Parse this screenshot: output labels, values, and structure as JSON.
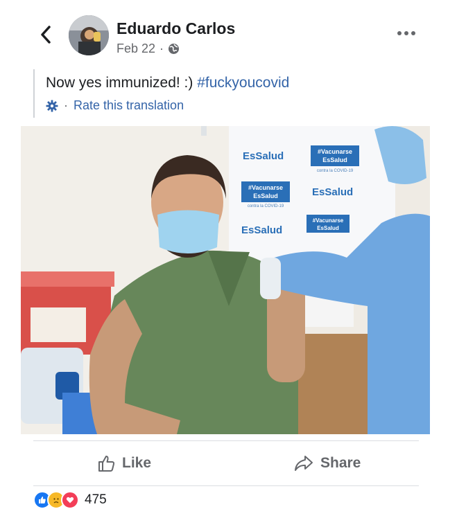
{
  "post": {
    "author": "Eduardo Carlos",
    "date": "Feb 22",
    "separator": "·",
    "text": "Now yes immunized! :) ",
    "hashtag": "#fuckyoucovid",
    "translate_separator": "·",
    "translate_label": "Rate this translation"
  },
  "photo": {
    "banner_brand": "EsSalud",
    "banner_tag_line1": "#Vacunarse",
    "banner_tag_line2": "EsSalud",
    "banner_small": "contra la COVID-19"
  },
  "actions": {
    "like_label": "Like",
    "share_label": "Share"
  },
  "reactions": {
    "count": "475",
    "icons": [
      "like-icon",
      "sad-icon",
      "love-icon"
    ]
  },
  "colors": {
    "link": "#3464a8",
    "secondary_text": "#65676b",
    "like_blue": "#1877f2",
    "love_red": "#f33e58",
    "sad_yellow": "#f7b928"
  }
}
